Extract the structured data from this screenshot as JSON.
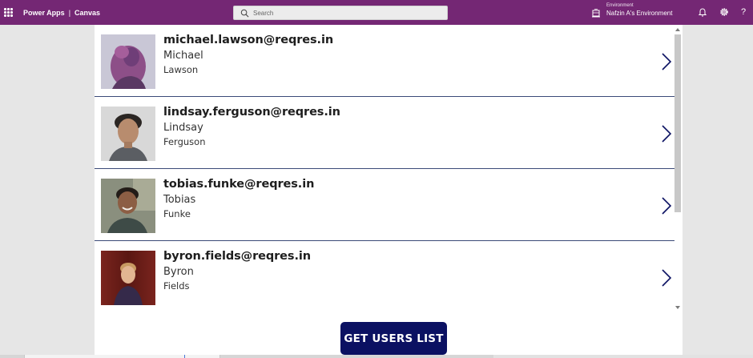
{
  "header": {
    "app_name": "Power Apps",
    "separator": "|",
    "app_mode": "Canvas",
    "search_placeholder": "Search",
    "environment_label": "Environment",
    "environment_name": "Nafzin A's Environment",
    "help_glyph": "?",
    "icons": [
      "app-launcher-icon",
      "search-icon",
      "environment-icon",
      "notifications-icon",
      "settings-icon",
      "help-icon"
    ],
    "brand_color": "#742774"
  },
  "users": [
    {
      "email": "michael.lawson@reqres.in",
      "first_name": "Michael",
      "last_name": "Lawson"
    },
    {
      "email": "lindsay.ferguson@reqres.in",
      "first_name": "Lindsay",
      "last_name": "Ferguson"
    },
    {
      "email": "tobias.funke@reqres.in",
      "first_name": "Tobias",
      "last_name": "Funke"
    },
    {
      "email": "byron.fields@reqres.in",
      "first_name": "Byron",
      "last_name": "Fields"
    }
  ],
  "gallery": {
    "row_icon": "chevron-right-icon",
    "divider_color": "#3b4a78"
  },
  "actions": {
    "get_users_label": "GET USERS LIST",
    "button_color": "#0b1162"
  }
}
